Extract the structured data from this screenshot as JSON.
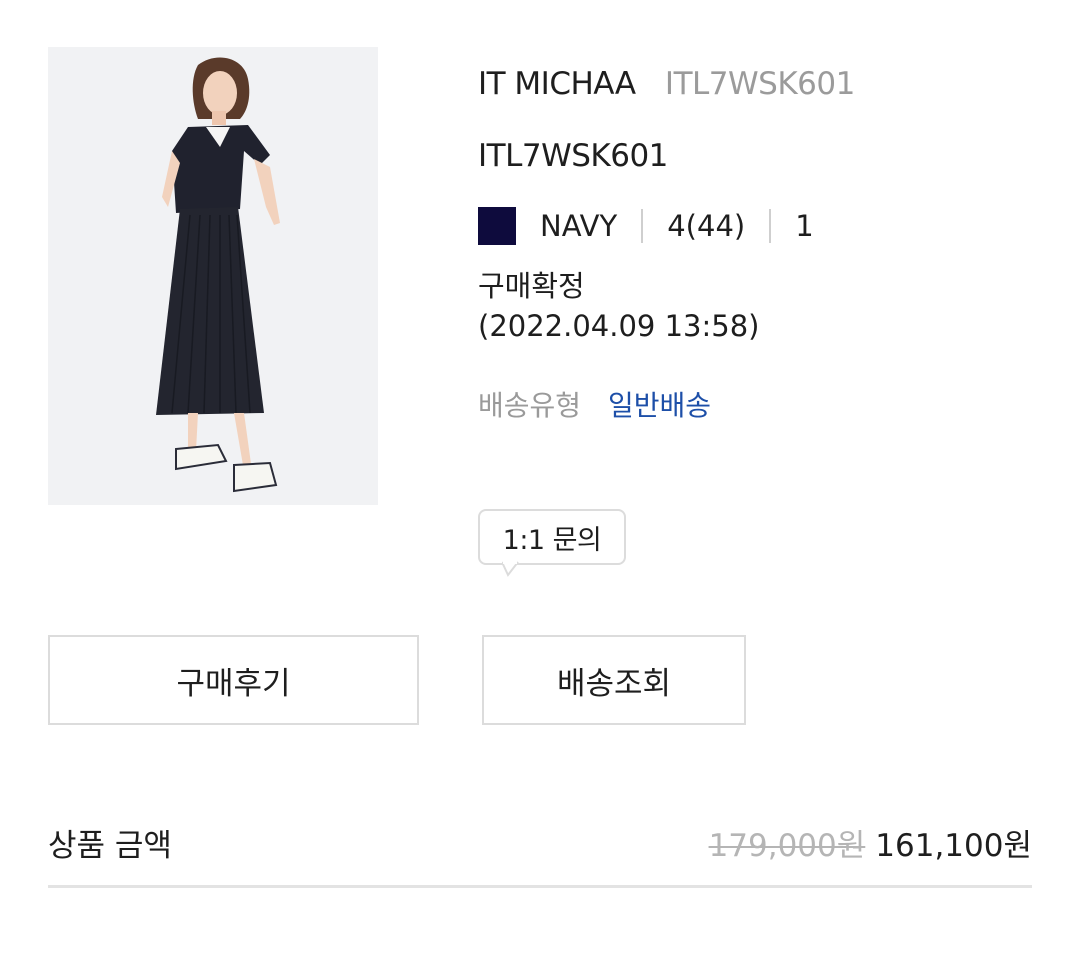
{
  "product": {
    "image_alt": "model wearing navy cropped jacket and pleated skirt",
    "brand": "IT MICHAA",
    "brand_code": "ITL7WSK601",
    "name": "ITL7WSK601"
  },
  "option": {
    "swatch_color": "#0e0b3d",
    "color": "NAVY",
    "size": "4(44)",
    "quantity": "1"
  },
  "order": {
    "status": "구매확정",
    "date": "(2022.04.09 13:58)"
  },
  "shipping": {
    "label": "배송유형",
    "value": "일반배송"
  },
  "inquiry": {
    "label": "1:1 문의"
  },
  "buttons": {
    "review": "구매후기",
    "track": "배송조회"
  },
  "price": {
    "label": "상품 금액",
    "original": "179,000원",
    "sale": "161,100원"
  },
  "colors": {
    "link_blue": "#1d4fa8",
    "muted_gray": "#9b9b9b",
    "border_gray": "#dcdcdc"
  }
}
